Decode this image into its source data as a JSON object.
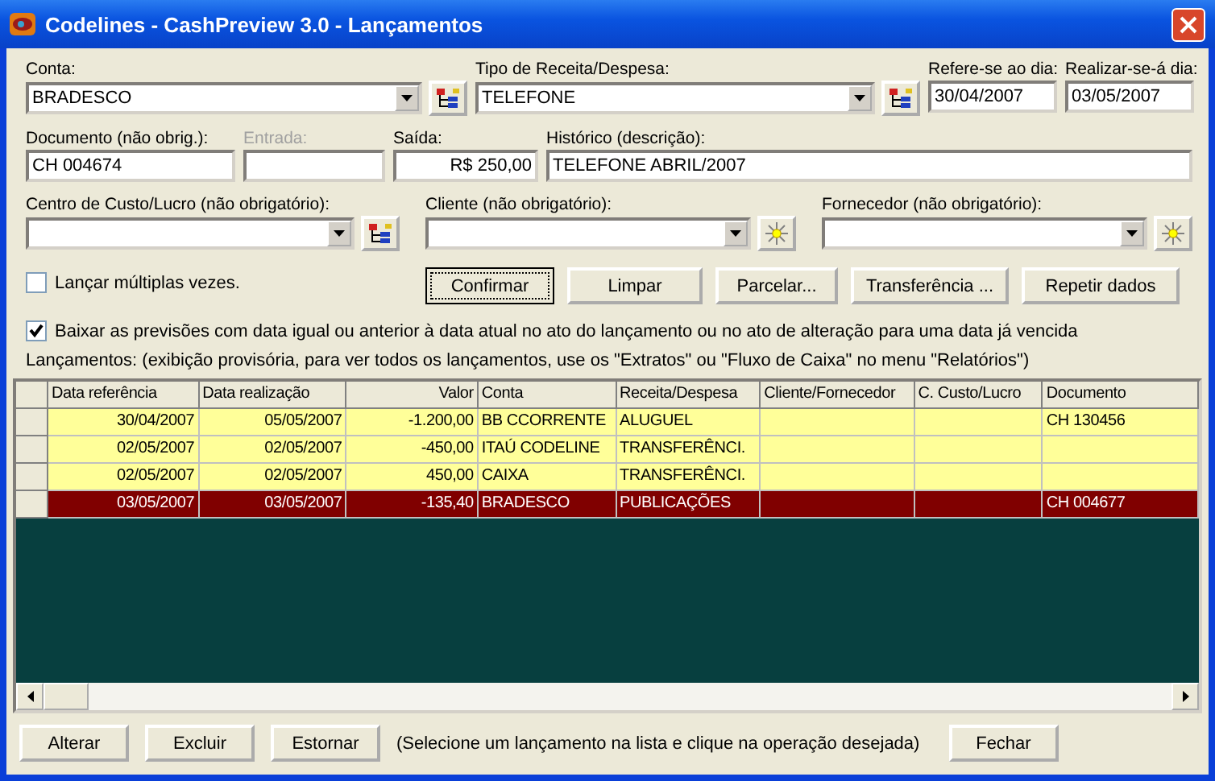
{
  "window": {
    "title": "Codelines - CashPreview 3.0 - Lançamentos"
  },
  "field_rows": [
    [
      {
        "kind": "tree_combo",
        "label": "Conta:",
        "value": "BRADESCO",
        "disabled": false
      },
      {
        "kind": "tree_combo",
        "label": "Tipo de Receita/Despesa:",
        "value": "TELEFONE",
        "disabled": false
      },
      {
        "kind": "text",
        "label": "Refere-se ao dia:",
        "value": "30/04/2007",
        "disabled": false
      },
      {
        "kind": "text",
        "label": "Realizar-se-á dia:",
        "value": "03/05/2007",
        "disabled": false
      }
    ],
    [
      {
        "kind": "text",
        "label": "Documento (não obrig.):",
        "value": "CH 004674",
        "disabled": false
      },
      {
        "kind": "text",
        "label": "Entrada:",
        "disabled": true
      },
      {
        "kind": "text",
        "label": "Saída:",
        "value": "R$ 250,00",
        "disabled": false
      },
      {
        "kind": "text",
        "label": "Histórico (descrição):",
        "value": "TELEFONE ABRIL/2007",
        "disabled": false
      }
    ],
    [
      {
        "kind": "tree_combo",
        "label": "Centro de Custo/Lucro (não obrigatório):",
        "disabled": false
      },
      {
        "kind": "sun_combo",
        "label": "Cliente (não obrigatório):",
        "disabled": false
      },
      {
        "kind": "sun_combo",
        "label": "Fornecedor (não obrigatório):",
        "disabled": false
      }
    ]
  ],
  "multiple": {
    "label": "Lançar múltiplas vezes.",
    "checked": false
  },
  "actions": [
    {
      "label": "Confirmar",
      "default": true
    },
    {
      "label": "Limpar",
      "default": false
    },
    {
      "label": "Parcelar...",
      "default": false
    },
    {
      "label": "Transferência ...",
      "default": false
    },
    {
      "label": "Repetir dados",
      "default": false
    }
  ],
  "baixar": {
    "label": "Baixar as previsões com data igual ou anterior à data atual no ato do lançamento ou no ato de alteração para uma data já vencida",
    "checked": true
  },
  "list_caption": "Lançamentos: (exibição provisória, para ver todos os lançamentos, use os \"Extratos\" ou \"Fluxo de Caixa\" no menu \"Relatórios\")",
  "table": {
    "columns": [
      "Data referência",
      "Data realização",
      "Valor",
      "Conta",
      "Receita/Despesa",
      "Cliente/Fornecedor",
      "C. Custo/Lucro",
      "Documento"
    ],
    "rows": [
      {
        "cells": [
          "30/04/2007",
          "05/05/2007",
          "-1.200,00",
          "BB CCORRENTE",
          "ALUGUEL",
          "",
          "",
          "CH 130456"
        ],
        "selected": false
      },
      {
        "cells": [
          "02/05/2007",
          "02/05/2007",
          "-450,00",
          "ITAÚ CODELINE",
          "TRANSFERÊNCI.",
          "",
          "",
          ""
        ],
        "selected": false
      },
      {
        "cells": [
          "02/05/2007",
          "02/05/2007",
          "450,00",
          "CAIXA",
          "TRANSFERÊNCI.",
          "",
          "",
          ""
        ],
        "selected": false
      },
      {
        "cells": [
          "03/05/2007",
          "03/05/2007",
          "-135,40",
          "BRADESCO",
          "PUBLICAÇÕES",
          "",
          "",
          "CH 004677"
        ],
        "selected": true
      }
    ]
  },
  "bottom_buttons": [
    "Alterar",
    "Excluir",
    "Estornar"
  ],
  "hint": "(Selecione um lançamento na lista e clique na operação desejada)",
  "close_button": "Fechar"
}
